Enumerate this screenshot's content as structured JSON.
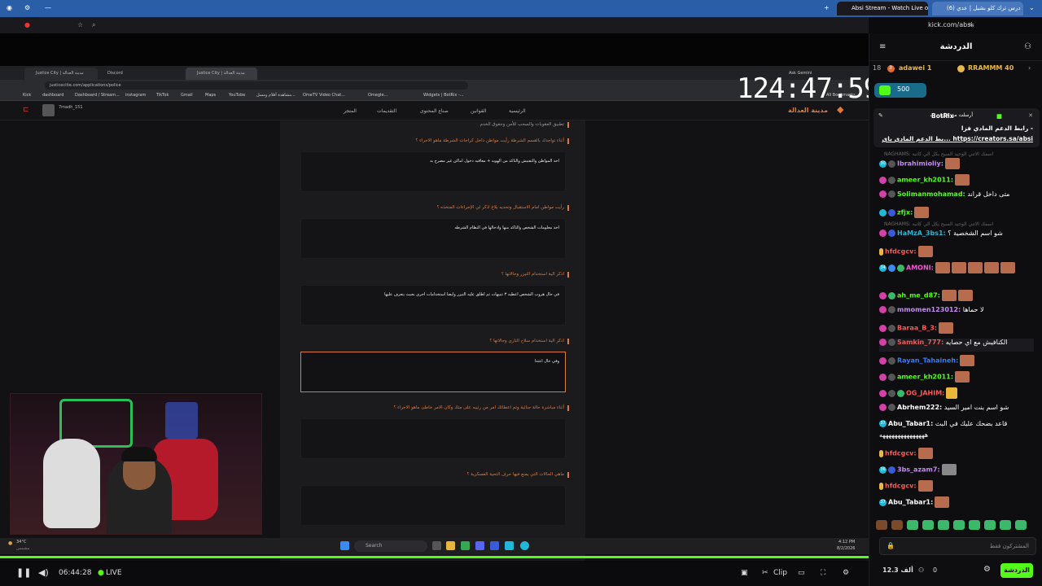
{
  "browser": {
    "tabs": [
      {
        "label": "Absi Stream - Watch Live o..."
      },
      {
        "label": "(6) درس ترك كلو بشيل | عدي"
      }
    ],
    "url": "kick.com/absi"
  },
  "inner_browser": {
    "tabs": [
      {
        "label": "Justice City | مدينة العدالة"
      },
      {
        "label": "Discord"
      },
      {
        "label": "Justice City | مدينة العدالة"
      }
    ],
    "url": "justicecitie.com/applications/police",
    "right_label": "Ask Gemini",
    "bookmarks": [
      "Kick",
      "dashboard",
      "Dashboard / Stream...",
      "instagram",
      "TikTok",
      "Gmail",
      "Maps",
      "YouTube",
      "مشاهدة أفلام ومسل...",
      "OmeTV Video Chat...",
      "Omegle...",
      "Widgets | BotRix -..."
    ],
    "all_bookmarks": "All Bookmarks"
  },
  "site": {
    "logo": "مدينة العدالة",
    "user": "7madh_151",
    "nav": [
      "الرئيسية",
      "القوانين",
      "صناع المحتوى",
      "التقديمات",
      "المتجر"
    ],
    "top_fragment": "تطبيق العقوبات والسحب للأمن وحقوق الخدم",
    "questions": [
      {
        "q": "أثناء تواجدك بالقسم الشرطة رأيت مواطن داخل كراجات الشرطة ماهو الاجراء ؟",
        "a": "اخذ المواطن والتفتيش والتاكد من الهويه + معاقبه دخول اماكن غير مصرح به"
      },
      {
        "q": "رأيت مواطن امام الاستقبال وتحديه بلاغ اذكر لي الإجراءات المتخذه ؟",
        "a": "اخذ معلومات الشخص والتاكد منها وادخالها في النظام الشرطه"
      },
      {
        "q": "اذكر الية استخدام التيزر وحالاتها ؟",
        "a": "في حال هروب الشخص اعطيه ٣ تنبيهات ثم اطلق عليه التيزر وايضا استخدامات اخرى بحيث يتعرف عليها"
      },
      {
        "q": "اذكر الية استخدام سلاح الناري وحالاتها ؟",
        "a": "وفي حال اعتدا"
      },
      {
        "q": "أثناء مباشرة حالة جنائية وتم اعطائك امر من رئيبه على متك وكان الامر خاطئ ماهو الاجراء ؟",
        "a": ""
      },
      {
        "q": "ماهي الحالات التي يمنع فيها حرف التحية العسكرية ؟",
        "a": ""
      }
    ]
  },
  "stream_clock": "124:47:59",
  "taskbar": {
    "weather": "34°C",
    "weather_sub": "مشمس",
    "search": "Search",
    "time": "4:12 PM",
    "date": "8/2/2026"
  },
  "player": {
    "elapsed": "06:44:28",
    "live": "LIVE",
    "clip": "Clip"
  },
  "chat": {
    "title": "الدردشة",
    "toprow": [
      {
        "text": "18",
        "color": "#aaaaaa"
      },
      {
        "text": "3",
        "color": "#aaaaaa"
      },
      {
        "text": "adawei 1",
        "color": "#e8b84a"
      },
      {
        "text": "RRAMMM 40",
        "color": "#e8b84a"
      }
    ],
    "gift": "500",
    "pinned": {
      "by": "BotRix",
      "label": "أرسلت من قبل",
      "line1": "- رابط الدعم المادي فزا",
      "line2": "https://creators.sa/absi ...بط الدعم المادي باي"
    },
    "messages": [
      {
        "user": "Ibrahimioliy:",
        "text": "",
        "color": "#c38cf0",
        "badge": "#1fb8d8",
        "num": "30",
        "emote": true
      },
      {
        "user": "ameer_kh2011:",
        "text": "",
        "color": "#53fc18",
        "badge": "#d53fa8",
        "num": "",
        "emote": true
      },
      {
        "user": "Solimanmohamad:",
        "text": "متى داخل قراند",
        "color": "#53fc18",
        "badge": "#d53fa8",
        "num": "",
        "emote": false
      },
      {
        "user": "zfjx:",
        "text": "",
        "color": "#53fc18",
        "badge": "#1fb8d8",
        "num": "",
        "emote": true
      },
      {
        "user": "HaMzA_3bs1:",
        "text": "شو اسم الشخصية ؟",
        "color": "#1fb8d8",
        "badge": "#d53fa8",
        "num": "",
        "emote": false
      },
      {
        "user": "hfdcgcv:",
        "text": "",
        "color": "#f05a5a",
        "badge": "",
        "num": "",
        "emote": true
      },
      {
        "user": "AMONI:",
        "text": "",
        "color": "#f05ad0",
        "badge": "#1fb8d8",
        "num": "34",
        "emote": true
      },
      {
        "user": "ah_me_d87:",
        "text": "",
        "color": "#53fc18",
        "badge": "#d53fa8",
        "num": "",
        "emote": true
      },
      {
        "user": "mmomen123012:",
        "text": "لا حماها",
        "color": "#c38cf0",
        "badge": "#d53fa8",
        "num": "",
        "emote": false
      },
      {
        "user": "Baraa_B_3:",
        "text": "",
        "color": "#f05a5a",
        "badge": "#d53fa8",
        "num": "",
        "emote": true
      },
      {
        "user": "Samkin_777:",
        "text": "الكنافيش مع اي حصايه",
        "color": "#f05a5a",
        "badge": "#d53fa8",
        "num": "",
        "emote": false
      },
      {
        "user": "Rayan_Tahaineh:",
        "text": "",
        "color": "#3b7cf0",
        "badge": "#d53fa8",
        "num": "",
        "emote": true
      },
      {
        "user": "ameer_kh2011:",
        "text": "",
        "color": "#53fc18",
        "badge": "#d53fa8",
        "num": "",
        "emote": true
      },
      {
        "user": "OG_JAHIM:",
        "text": "",
        "color": "#f05a5a",
        "badge": "#d53fa8",
        "num": "",
        "emote": true
      },
      {
        "user": "Abrhem222:",
        "text": "شو اسم بنت امير السيد",
        "color": "#ffffff",
        "badge": "#d53fa8",
        "num": "",
        "emote": false
      },
      {
        "user": "Abu_Tabar1:",
        "text": "قاعد بضحك عليك في البث",
        "color": "#ffffff",
        "badge": "#1fb8d8",
        "num": "37",
        "emote": false
      },
      {
        "user": "",
        "text": "هههههههههههههههه",
        "color": "#ffffff",
        "badge": "",
        "num": "",
        "emote": false
      },
      {
        "user": "hfdcgcv:",
        "text": "",
        "color": "#f05a5a",
        "badge": "",
        "num": "",
        "emote": true
      },
      {
        "user": "3bs_azam7:",
        "text": "",
        "color": "#c38cf0",
        "badge": "#1fb8d8",
        "num": "36",
        "emote": true
      },
      {
        "user": "hfdcgcv:",
        "text": "",
        "color": "#f05a5a",
        "badge": "",
        "num": "",
        "emote": true
      },
      {
        "user": "Abu_Tabar1:",
        "text": "",
        "color": "#ffffff",
        "badge": "#1fb8d8",
        "num": "37",
        "emote": true
      }
    ],
    "ghost1": "NAGHAMS: اسمك الاتني الوحيد السبح بكل الي كاتبه",
    "ghost2": "NAGHAMS: اسمك الاتني الوحيد السبح بكل الي كاتبه",
    "input_placeholder": "المشتركون فقط",
    "viewers": "12.3 ألف",
    "count": "0",
    "chat_button": "الدردشة"
  }
}
